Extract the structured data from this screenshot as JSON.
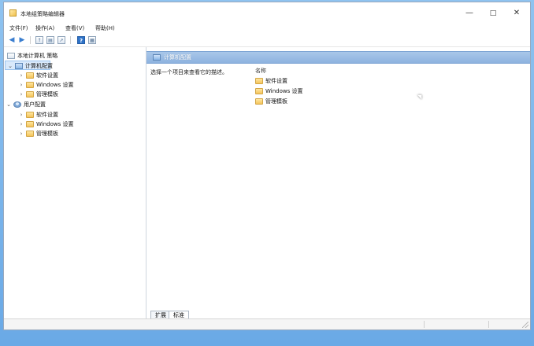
{
  "window": {
    "title": "本地组策略编辑器",
    "controls": {
      "minimize": "—",
      "maximize": "□",
      "close": "✕"
    }
  },
  "menu": {
    "items": [
      "文件(F)",
      "操作(A)",
      "查看(V)",
      "帮助(H)"
    ]
  },
  "toolbar": {
    "back": "◀",
    "forward": "▶",
    "up": "↑",
    "show_hide": "▤",
    "export": "↗",
    "help": "?",
    "properties": "▦"
  },
  "tree": {
    "root": "本地计算机 策略",
    "computer": "计算机配置",
    "computer_children": [
      "软件设置",
      "Windows 设置",
      "管理模板"
    ],
    "user": "用户配置",
    "user_children": [
      "软件设置",
      "Windows 设置",
      "管理模板"
    ],
    "expand_open": "⌄",
    "expand_closed": "›"
  },
  "detail": {
    "title": "计算机配置",
    "description": "选择一个项目来查看它的描述。",
    "column_name": "名称",
    "items": [
      "软件设置",
      "Windows 设置",
      "管理模板"
    ]
  },
  "tabs": {
    "extended": "扩展",
    "standard": "标准"
  },
  "colors": {
    "desktop": "#7fb6ea",
    "selection": "#d9e9fb",
    "header": "#8db2df"
  }
}
